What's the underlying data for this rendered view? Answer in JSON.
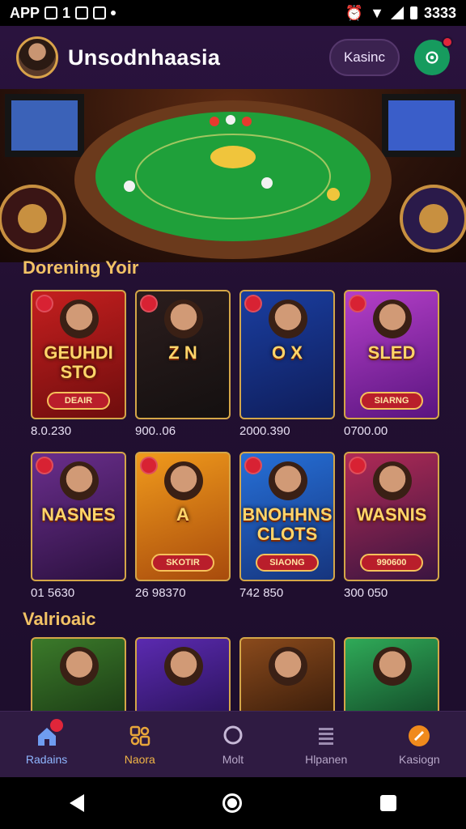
{
  "status_bar": {
    "left_text": "APP",
    "digit": "1",
    "time": "3333"
  },
  "header": {
    "title": "Unsodnhaasia",
    "pill_button": "Kasinc"
  },
  "sections": [
    {
      "title": "Dorening Yoir"
    },
    {
      "title": "Valrioaic"
    }
  ],
  "games_row1": [
    {
      "name": "GEUHDI STO",
      "cta": "DEAIR",
      "amount": "8.0.230",
      "colors": [
        "#c51f1f",
        "#6e0d0d"
      ]
    },
    {
      "name": "Z N",
      "cta": "",
      "amount": "900..06",
      "colors": [
        "#2b1d1d",
        "#141010"
      ]
    },
    {
      "name": "O X",
      "cta": "",
      "amount": "2000.390",
      "colors": [
        "#1a3ea0",
        "#0f1d5a"
      ]
    },
    {
      "name": "SLED",
      "cta": "SIARNG",
      "amount": "0700.00",
      "colors": [
        "#b43fc8",
        "#5a1580"
      ]
    }
  ],
  "games_row2": [
    {
      "name": "NASNES",
      "cta": "",
      "amount": "01 5630",
      "colors": [
        "#6a2e8c",
        "#2c1140"
      ]
    },
    {
      "name": "A",
      "cta": "SKOTIR",
      "amount": "26 98370",
      "colors": [
        "#f09a1c",
        "#a84b0c"
      ]
    },
    {
      "name": "BNOHHNS CLOTS",
      "cta": "SIAONG",
      "amount": "742 850",
      "colors": [
        "#2670d8",
        "#16357e"
      ]
    },
    {
      "name": "WASNIS",
      "cta": "990600",
      "amount": "300 050",
      "colors": [
        "#b02a56",
        "#3a1540"
      ]
    }
  ],
  "games_row3": [
    {
      "colors": [
        "#3b7a2a",
        "#173312"
      ]
    },
    {
      "colors": [
        "#5b2ab0",
        "#241050"
      ]
    },
    {
      "colors": [
        "#8a4a1c",
        "#2e1608"
      ]
    },
    {
      "colors": [
        "#2faa58",
        "#0f3e22"
      ]
    }
  ],
  "bottom_nav": [
    {
      "label": "Radains",
      "icon": "home-icon"
    },
    {
      "label": "Naora",
      "icon": "games-icon"
    },
    {
      "label": "Molt",
      "icon": "search-icon"
    },
    {
      "label": "Hlpanen",
      "icon": "list-icon"
    },
    {
      "label": "Kasiogn",
      "icon": "promo-icon"
    }
  ]
}
